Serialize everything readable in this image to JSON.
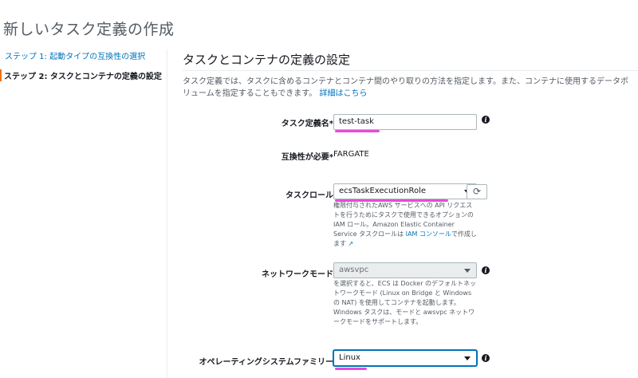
{
  "page": {
    "title": "新しいタスク定義の作成"
  },
  "sidebar": {
    "step1": "ステップ 1: 起動タイプの互換性の選択",
    "step2": "ステップ 2: タスクとコンテナの定義の設定"
  },
  "section": {
    "title": "タスクとコンテナの定義の設定",
    "description": "タスク定義では、タスクに含めるコンテナとコンテナ間のやり取りの方法を指定します。また、コンテナに使用するデータボリュームを指定することもできます。",
    "learn_more": "詳細はこちら"
  },
  "form": {
    "task_name": {
      "label": "タスク定義名*",
      "value": "test-task"
    },
    "compatibility": {
      "label": "互換性が必要*",
      "value": "FARGATE"
    },
    "task_role": {
      "label": "タスクロール",
      "value": "ecsTaskExecutionRole",
      "help": "権限付与されたAWS サービスへの API リクエストを行うためにタスクで使用できるオプションの IAM ロール。Amazon Elastic Container Service タスクロールは",
      "help_link": "IAM コンソール",
      "help_suffix": "で作成します"
    },
    "network_mode": {
      "label": "ネットワークモード",
      "value": "awsvpc",
      "help": "を選択すると、ECS は Docker のデフォルトネットワークモード (Linux on Bridge と Windows の NAT) を使用してコンテナを起動します。Windows タスクは、モードと awsvpc ネットワークモードをサポートします。"
    },
    "os_family": {
      "label": "オペレーティングシステムファミリー",
      "value": "Linux"
    }
  },
  "icons": {
    "info": "i",
    "refresh": "⟳",
    "external": "↗"
  },
  "colors": {
    "accent_link": "#0073bb",
    "step_marker": "#ec7211",
    "annotation": "#e64cd9"
  }
}
